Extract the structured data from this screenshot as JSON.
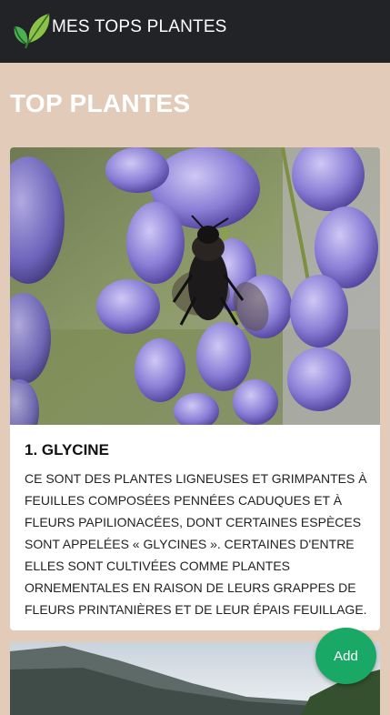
{
  "navbar": {
    "logo_icon": "leaves-logo-icon",
    "title": "MES TOPS PLANTES"
  },
  "page": {
    "heading": "TOP PLANTES"
  },
  "cards": [
    {
      "image_icon": "wisteria-bee-photo",
      "title": "1. GLYCINE",
      "text": "Ce sont des plantes ligneuses et grimpantes à feuilles composées pennées caduques et à fleurs papilionacées, dont certaines espèces sont appelées « glycines ». Certaines d'entre elles sont cultivées comme plantes ornementales en raison de leurs grappes de fleurs printanières et de leur épais feuillage."
    },
    {
      "image_icon": "mountain-landscape-photo"
    }
  ],
  "fab": {
    "label": "Add",
    "color": "#1aa866"
  },
  "colors": {
    "background": "#e2cbb8",
    "navbar": "#222326"
  }
}
